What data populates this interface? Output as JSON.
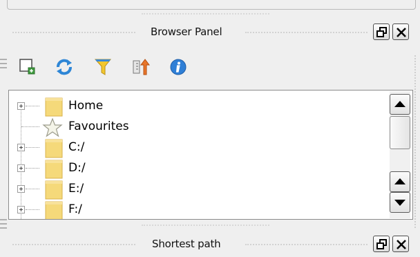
{
  "panels": {
    "browser": {
      "title": "Browser Panel"
    },
    "shortest_path": {
      "title": "Shortest path"
    }
  },
  "toolbar": {
    "items": [
      {
        "name": "add-layer",
        "icon": "add-layer-icon"
      },
      {
        "name": "refresh",
        "icon": "refresh-icon"
      },
      {
        "name": "filter",
        "icon": "filter-icon"
      },
      {
        "name": "collapse-all",
        "icon": "collapse-icon"
      },
      {
        "name": "properties",
        "icon": "info-icon"
      }
    ]
  },
  "tree": {
    "items": [
      {
        "label": "Home",
        "icon": "folder-icon",
        "expandable": true
      },
      {
        "label": "Favourites",
        "icon": "star-icon",
        "expandable": false
      },
      {
        "label": "C:/",
        "icon": "folder-icon",
        "expandable": true
      },
      {
        "label": "D:/",
        "icon": "folder-icon",
        "expandable": true
      },
      {
        "label": "E:/",
        "icon": "folder-icon",
        "expandable": true
      },
      {
        "label": "F:/",
        "icon": "folder-icon",
        "expandable": true
      }
    ]
  },
  "colors": {
    "folder": "#f5d97a",
    "folder_edge": "#d9b24c",
    "refresh": "#2e86d6",
    "info": "#2f7fd6",
    "filter": "#f2c72e"
  }
}
